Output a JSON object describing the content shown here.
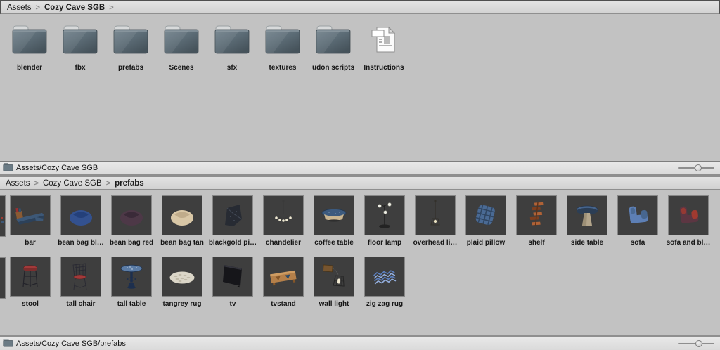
{
  "window": {
    "breadcrumb_separator": ">"
  },
  "panel_top": {
    "breadcrumb": {
      "segments": [
        {
          "label": "Assets",
          "bold": false
        },
        {
          "label": "Cozy Cave SGB",
          "bold": true
        }
      ],
      "trailing_chevron": true
    },
    "items": [
      {
        "label": "blender",
        "type": "folder"
      },
      {
        "label": "fbx",
        "type": "folder"
      },
      {
        "label": "prefabs",
        "type": "folder"
      },
      {
        "label": "Scenes",
        "type": "folder"
      },
      {
        "label": "sfx",
        "type": "folder"
      },
      {
        "label": "textures",
        "type": "folder"
      },
      {
        "label": "udon scripts",
        "type": "folder"
      },
      {
        "label": "Instructions",
        "type": "document"
      }
    ],
    "status": {
      "path": "Assets/Cozy Cave SGB",
      "zoom_percent": 56
    }
  },
  "panel_bottom": {
    "breadcrumb": {
      "segments": [
        {
          "label": "Assets",
          "bold": false
        },
        {
          "label": "Cozy Cave SGB",
          "bold": false
        },
        {
          "label": "prefabs",
          "bold": true
        }
      ],
      "trailing_chevron": false
    },
    "rows": [
      [
        {
          "label": "bar",
          "icon": "bar",
          "colors": [
            "#3d5877",
            "#8a5a33",
            "#9c2f2f"
          ]
        },
        {
          "label": "bean bag bl…",
          "icon": "beanbag",
          "colors": [
            "#33518f",
            "#24407a"
          ]
        },
        {
          "label": "bean bag red",
          "icon": "beanbag",
          "colors": [
            "#4d3847",
            "#3a2a38"
          ]
        },
        {
          "label": "bean bag tan",
          "icon": "beanbag",
          "colors": [
            "#d9c7a6",
            "#c0ac8b"
          ]
        },
        {
          "label": "blackgold pi…",
          "icon": "pillow-dark",
          "colors": [
            "#272b33",
            "#5d6878"
          ]
        },
        {
          "label": "chandelier",
          "icon": "chandelier",
          "colors": [
            "#3a3a3a",
            "#efe9d2"
          ]
        },
        {
          "label": "coffee table",
          "icon": "coffee-table",
          "colors": [
            "#3c5a7e",
            "#c9b591"
          ]
        },
        {
          "label": "floor lamp",
          "icon": "floor-lamp",
          "colors": [
            "#232323",
            "#eeeee4"
          ]
        },
        {
          "label": "overhead li…",
          "icon": "overhead-light",
          "colors": [
            "#33302a",
            "#e8e0c0"
          ]
        },
        {
          "label": "plaid pillow",
          "icon": "plaid-pillow",
          "colors": [
            "#4a6a94",
            "#283a52"
          ]
        },
        {
          "label": "shelf",
          "icon": "shelf",
          "colors": [
            "#b06236",
            "#7d3f20"
          ]
        },
        {
          "label": "side table",
          "icon": "side-table",
          "colors": [
            "#46648c",
            "#b3a58b"
          ]
        },
        {
          "label": "sofa",
          "icon": "sofa",
          "colors": [
            "#5d7fb5",
            "#47668f"
          ]
        },
        {
          "label": "sofa and bl…",
          "icon": "sofa",
          "colors": [
            "#5c3642",
            "#a03a30"
          ]
        }
      ],
      [
        {
          "label": "stool",
          "icon": "stool",
          "colors": [
            "#a23a3a",
            "#23232a"
          ]
        },
        {
          "label": "tall chair",
          "icon": "tall-chair",
          "colors": [
            "#2a2a33",
            "#a23a3a"
          ]
        },
        {
          "label": "tall table",
          "icon": "tall-table",
          "colors": [
            "#5b7ca6",
            "#1d2f4e"
          ]
        },
        {
          "label": "tangrey rug",
          "icon": "round-rug",
          "colors": [
            "#dbd6c8",
            "#b9b2a0"
          ]
        },
        {
          "label": "tv",
          "icon": "tv",
          "colors": [
            "#16161a",
            "#34343c"
          ]
        },
        {
          "label": "tvstand",
          "icon": "tvstand",
          "colors": [
            "#b5804a",
            "#855628"
          ]
        },
        {
          "label": "wall light",
          "icon": "wall-light",
          "colors": [
            "#77552f",
            "#262626"
          ]
        },
        {
          "label": "zig zag rug",
          "icon": "zigzag-rug",
          "colors": [
            "#5b7fc0",
            "#93aedd"
          ]
        }
      ]
    ],
    "status": {
      "path": "Assets/Cozy Cave SGB/prefabs",
      "zoom_percent": 58
    }
  },
  "colors": {
    "content_bg": "#c2c2c2",
    "tile_bg": "#3e3e3e",
    "folder_body": "#5e6f79",
    "folder_body_dark": "#49565e",
    "folder_tab": "#d8dadb",
    "bar_bg_light": "#e3e3e3",
    "separator": "#8f8f8f"
  }
}
